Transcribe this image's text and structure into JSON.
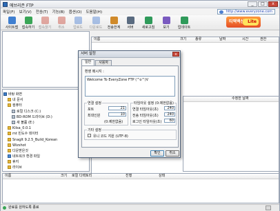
{
  "app": {
    "title": "에브리존 FTP"
  },
  "window_buttons": {
    "minimize": "_",
    "maximize": "□",
    "close": "x"
  },
  "menu": [
    "파일(F)",
    "보기(V)",
    "전송(T)",
    "기능(B)",
    "옵션(O)",
    "도움말(H)"
  ],
  "url": "http://www.everyzone.com",
  "toolbar": [
    {
      "label": "사이트맵",
      "icon": "sitemap-icon",
      "enabled": true,
      "color": "#3f7fd0"
    },
    {
      "label": "접속하기",
      "icon": "connect-icon",
      "enabled": true,
      "color": "#3aa556"
    },
    {
      "label": "접속끊기",
      "icon": "disconnect-icon",
      "enabled": false,
      "color": "#c84a3a"
    },
    {
      "label": "취소",
      "icon": "cancel-icon",
      "enabled": false,
      "color": "#c84a3a"
    },
    {
      "label": "업로드",
      "icon": "upload-icon",
      "enabled": false,
      "color": "#4c7fd0"
    },
    {
      "label": "다운로드",
      "icon": "download-icon",
      "enabled": false,
      "color": "#4c7fd0"
    },
    {
      "label": "전송한계",
      "icon": "transfer-limit-icon",
      "enabled": true,
      "color": "#d08a2a"
    },
    {
      "label": "서버",
      "icon": "server-icon",
      "enabled": true,
      "color": "#5a6b80"
    },
    {
      "label": "새로고침",
      "icon": "refresh-icon",
      "enabled": true,
      "color": "#2f9a5a"
    },
    {
      "label": "보기",
      "icon": "view-icon",
      "enabled": true,
      "color": "#7a5ac0"
    },
    {
      "label": "업데이트",
      "icon": "update-icon",
      "enabled": true,
      "color": "#2f9a5a"
    }
  ],
  "banner": {
    "text": "티맥백신",
    "badge": "Lite"
  },
  "remote_pane": {
    "columns": [
      "이름",
      "크기",
      "종류",
      "날짜",
      "시간",
      "권한"
    ]
  },
  "local_pane": {
    "columns": [
      "",
      "수정한 날짜"
    ]
  },
  "tree": [
    {
      "label": "바탕 화면",
      "icon": "desktop",
      "indent": 0
    },
    {
      "label": "내 문서",
      "icon": "folder",
      "indent": 1
    },
    {
      "label": "컴퓨터",
      "icon": "folder",
      "indent": 1
    },
    {
      "label": "로컬 디스크 (C:)",
      "icon": "drive",
      "indent": 2
    },
    {
      "label": "BD-ROM 드라이브 (D:)",
      "icon": "drive",
      "indent": 2
    },
    {
      "label": "새 볼륨 (E:)",
      "icon": "drive",
      "indent": 2
    },
    {
      "label": "Kilsa_0.0.1",
      "icon": "folder",
      "indent": 1
    },
    {
      "label": "mt 빈도수 데이터",
      "icon": "folder",
      "indent": 1
    },
    {
      "label": "SnagIt 9.2.5_Build_Korean",
      "icon": "folder",
      "indent": 1
    },
    {
      "label": "Wizshot",
      "icon": "folder",
      "indent": 1
    },
    {
      "label": "다운받은것",
      "icon": "folder",
      "indent": 1
    },
    {
      "label": "네트워크 환경 파일",
      "icon": "net",
      "indent": 1
    },
    {
      "label": "휴지",
      "icon": "folder",
      "indent": 1
    },
    {
      "label": "라이브",
      "icon": "folder",
      "indent": 1
    }
  ],
  "queue_pane": {
    "columns": [
      "이름",
      "크기",
      "로컬 디렉토리",
      "진행",
      "상태"
    ]
  },
  "status": {
    "text": "연결되지 않음",
    "alt": "완료를 원하도록 종료"
  },
  "dialog": {
    "title": "서버 설정",
    "close": "x",
    "tabs": [
      "일반",
      "사용자"
    ],
    "welcome_label": "환영 메시지 :",
    "welcome_text": "Welcome To EveryZone FTP (^o^)V",
    "conn_group": "연결 설정",
    "port_label": "포트",
    "port_value": "21",
    "max_users_label": "최대인원",
    "max_users_value": "10",
    "unlimited_note": "(0:제한없음)",
    "timeout_group": "타임아웃 설정 (0:제한없음)",
    "conn_timeout_label": "연결 타임아웃(초)",
    "conn_timeout_value": "240",
    "transfer_timeout_label": "전송 타임아웃(초)",
    "transfer_timeout_value": "240",
    "login_timeout_label": "로그인 타임아웃(초)",
    "login_timeout_value": "60",
    "other_group": "기타 설정",
    "utf8_label": "유니 코드 지원 (UTF-8)",
    "ok": "확인",
    "cancel": "취소"
  }
}
